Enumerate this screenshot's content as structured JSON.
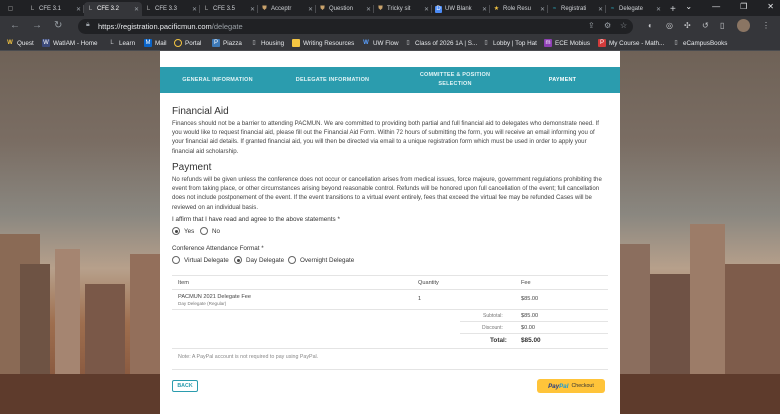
{
  "browser": {
    "tabs": [
      {
        "title": "CFE 3.1",
        "icon": "L"
      },
      {
        "title": "CFE 3.2",
        "icon": "L"
      },
      {
        "title": "CFE 3.3",
        "icon": "L"
      },
      {
        "title": "CFE 3.5",
        "icon": "L"
      },
      {
        "title": "Acceptr",
        "icon": "shield"
      },
      {
        "title": "Question",
        "icon": "shield"
      },
      {
        "title": "Tricky sit",
        "icon": "shield"
      },
      {
        "title": "UW Blank",
        "icon": "D"
      },
      {
        "title": "Role Resu",
        "icon": "star"
      },
      {
        "title": "Registrati",
        "icon": "wave"
      },
      {
        "title": "Delegate",
        "icon": "wave"
      }
    ],
    "url_host": "https://registration.pacificmun.com",
    "url_path": "/delegate",
    "bookmarks": [
      {
        "label": "Quest",
        "icon": "W"
      },
      {
        "label": "WatIAM - Home",
        "icon": "W"
      },
      {
        "label": "Learn",
        "icon": "L"
      },
      {
        "label": "Mail",
        "icon": "M"
      },
      {
        "label": "Portal",
        "icon": "O"
      },
      {
        "label": "Piazza",
        "icon": "P"
      },
      {
        "label": "Housing",
        "icon": "doc"
      },
      {
        "label": "Writing Resources",
        "icon": "doc"
      },
      {
        "label": "UW Flow",
        "icon": "W"
      },
      {
        "label": "Class of 2026 1A | S...",
        "icon": "doc"
      },
      {
        "label": "Lobby | Top Hat",
        "icon": "doc"
      },
      {
        "label": "ECE Mobius",
        "icon": "m"
      },
      {
        "label": "My Course - Math...",
        "icon": "P"
      },
      {
        "label": "eCampusBooks",
        "icon": "doc"
      }
    ],
    "colors": {
      "frame": "#202124",
      "toolbar": "#35363a",
      "accent": "#2b9cae",
      "paypal": "#ffc43a"
    }
  },
  "steps": [
    {
      "label": "GENERAL INFORMATION"
    },
    {
      "label": "DELEGATE INFORMATION"
    },
    {
      "label": "COMMITTEE & POSITION SELECTION"
    },
    {
      "label": "PAYMENT"
    }
  ],
  "financial_aid": {
    "heading": "Financial Aid",
    "body": "Finances should not be a barrier to attending PACMUN. We are committed to providing both partial and full financial aid to delegates who demonstrate need. If you would like to request financial aid, please fill out the Financial Aid Form. Within 72 hours of submitting the form, you will receive an email informing you of your financial aid details. If granted financial aid, you will then be directed via email to a unique registration form which must be used in order to apply your financial aid scholarship."
  },
  "payment": {
    "heading": "Payment",
    "body": "No refunds will be given unless the conference does not occur or cancellation arises from medical issues, force majeure, government regulations prohibiting the event from taking place, or other circumstances arising beyond reasonable control. Refunds will be honored upon full cancellation of the event; full cancellation does not include postponement of the event. If the event transitions to a virtual event entirely, fees that exceed the virtual fee may be refunded Cases will be reviewed on an individual basis."
  },
  "affirm": {
    "label": "I affirm that I have read and agree to the above statements *",
    "options": [
      "Yes",
      "No"
    ],
    "selected": "Yes"
  },
  "format": {
    "label": "Conference Attendance Format *",
    "options": [
      "Virtual Delegate",
      "Day Delegate",
      "Overnight Delegate"
    ],
    "selected": "Day Delegate"
  },
  "table": {
    "headers": {
      "item": "Item",
      "quantity": "Quantity",
      "fee": "Fee"
    },
    "row": {
      "item": "PACMUN 2021 Delegate Fee",
      "sub": "Day Delegate (Regular)",
      "quantity": "1",
      "fee": "$85.00"
    },
    "subtotal_label": "Subtotal:",
    "subtotal": "$85.00",
    "discount_label": "Discount:",
    "discount": "$0.00",
    "total_label": "Total:",
    "total": "$85.00"
  },
  "note": "Note: A PayPal account is not required to pay using PayPal.",
  "buttons": {
    "back": "BACK",
    "paypal_1": "Pay",
    "paypal_2": "Pal",
    "paypal_3": "Checkout"
  }
}
